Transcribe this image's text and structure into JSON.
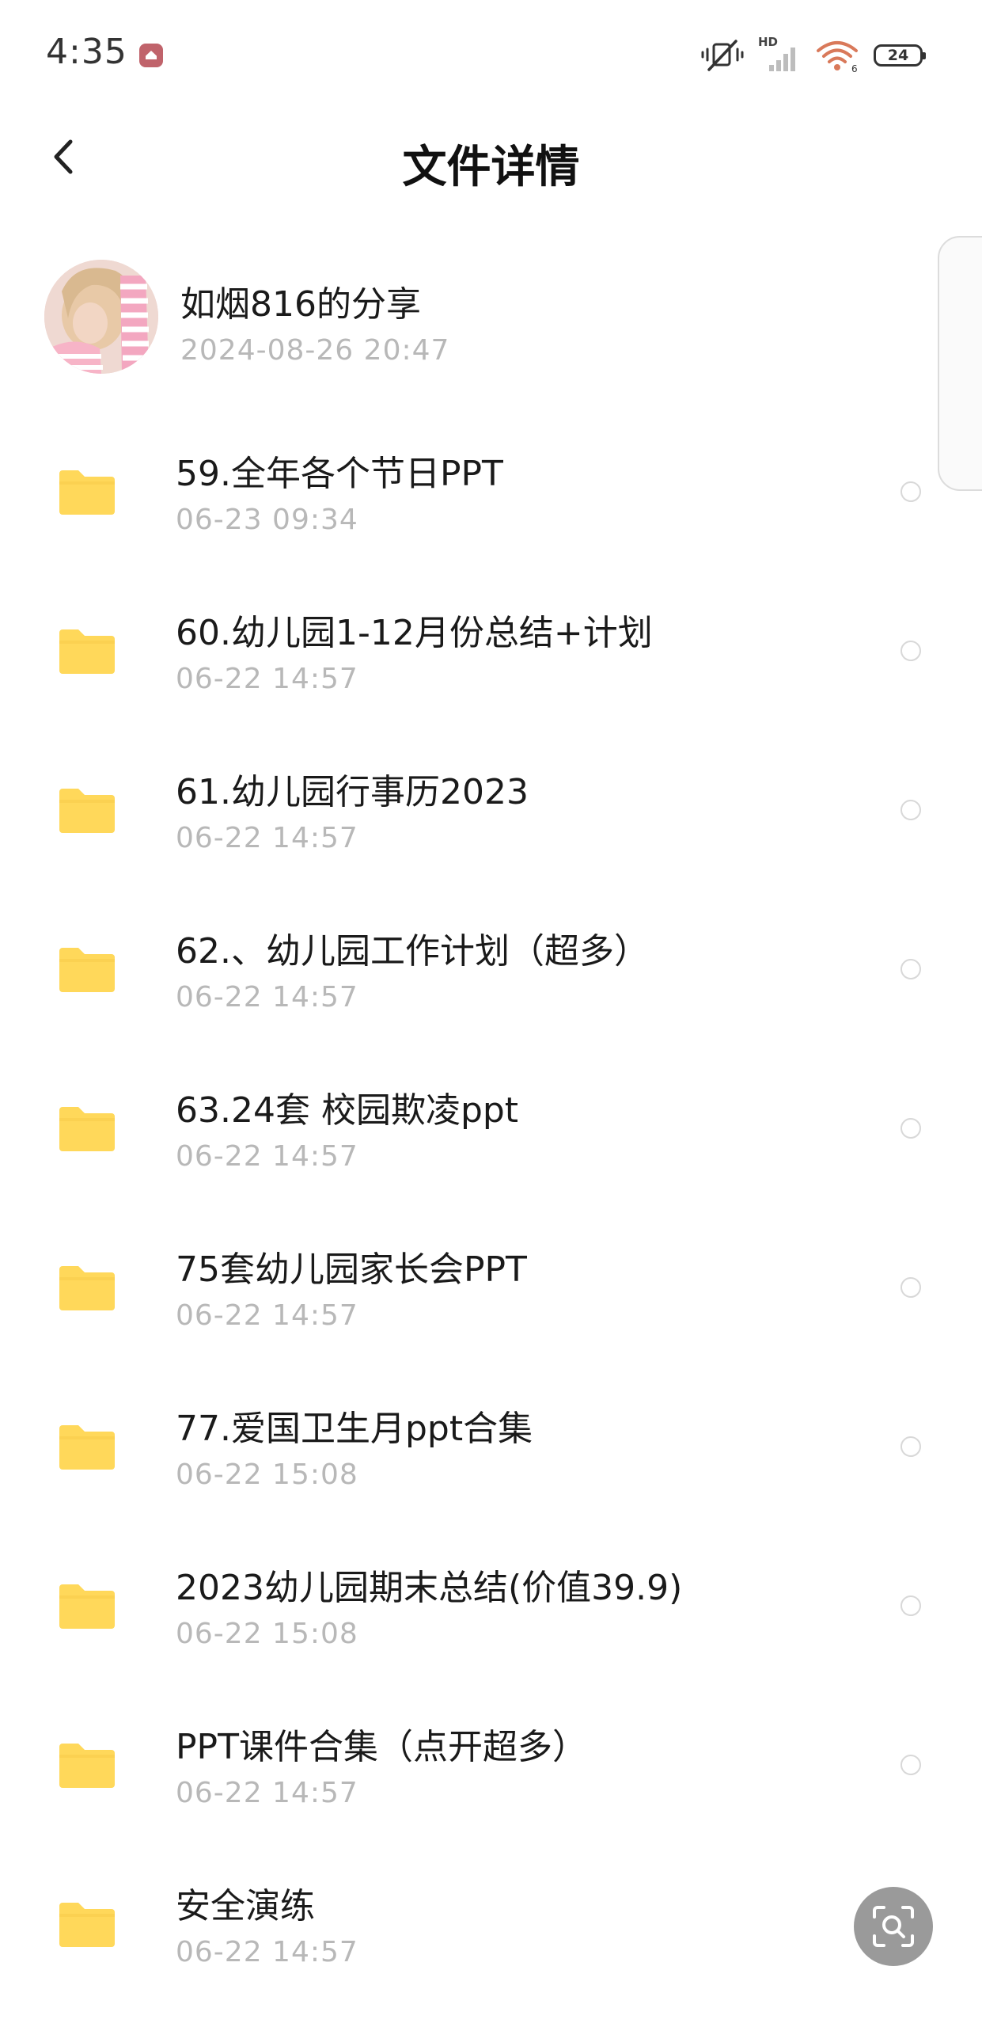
{
  "status_bar": {
    "time": "4:35",
    "battery": "24",
    "icons": [
      "app-notification-icon",
      "vibrate-off-icon",
      "hd-signal-icon",
      "wifi-icon",
      "battery-icon"
    ],
    "network_label": "HD"
  },
  "header": {
    "title": "文件详情",
    "back_icon": "chevron-left-icon"
  },
  "sharer": {
    "name": "如烟816的分享",
    "time": "2024-08-26  20:47"
  },
  "files": [
    {
      "name": "59.全年各个节日PPT",
      "time": "06-23  09:34"
    },
    {
      "name": "60.幼儿园1-12月份总结+计划",
      "time": "06-22  14:57"
    },
    {
      "name": "61.幼儿园行事历2023",
      "time": "06-22  14:57"
    },
    {
      "name": "62.、幼儿园工作计划（超多）",
      "time": "06-22  14:57"
    },
    {
      "name": "63.24套  校园欺凌ppt",
      "time": "06-22  14:57"
    },
    {
      "name": "75套幼儿园家长会PPT",
      "time": "06-22  14:57"
    },
    {
      "name": "77.爱国卫生月ppt合集",
      "time": "06-22  15:08"
    },
    {
      "name": "2023幼儿园期末总结(价值39.9)",
      "time": "06-22  15:08"
    },
    {
      "name": "PPT课件合集（点开超多）",
      "time": "06-22  14:57"
    },
    {
      "name": "安全演练",
      "time": "06-22  14:57"
    }
  ],
  "colors": {
    "folder": "#FFD85A",
    "folder_tab": "#F7C948",
    "secondary_text": "#B8B8B8",
    "fab": "#9A9A9A"
  }
}
